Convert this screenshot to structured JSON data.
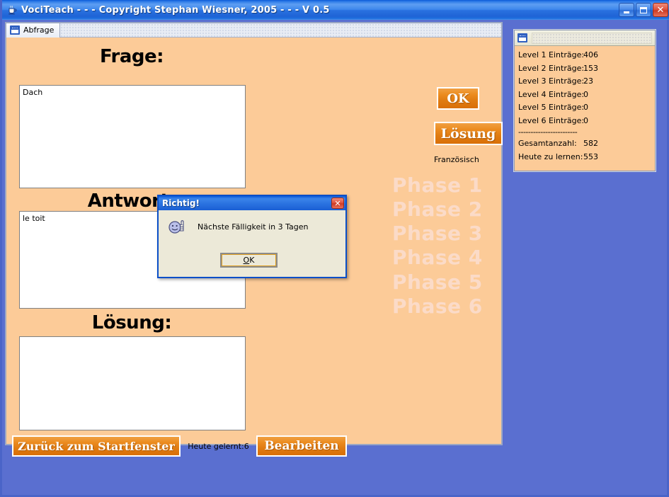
{
  "window": {
    "title": "VociTeach - - - Copyright Stephan Wiesner, 2005 - - -  V 0.5",
    "icon": "java-coffee-cup-icon",
    "minimize_label": "_",
    "maximize_label": "□",
    "close_label": "✕"
  },
  "main_frame": {
    "tab_label": "Abfrage",
    "tab_icon": "window-icon"
  },
  "quiz": {
    "frage_label": "Frage:",
    "frage_value": "Dach",
    "antwort_label": "Antwort:",
    "antwort_value": "le toit",
    "loesung_label": "Lösung:",
    "loesung_value": "",
    "ok_button": "OK",
    "loesung_button": "Lösung",
    "language": "Französisch",
    "phases": [
      "Phase 1",
      "Phase 2",
      "Phase 3",
      "Phase 4",
      "Phase 5",
      "Phase 6"
    ]
  },
  "bottom_bar": {
    "back_button": "Zurück zum Startfenster",
    "learned_today": "Heute gelernt:6",
    "edit_button": "Bearbeiten"
  },
  "stats_frame": {
    "icon": "window-icon",
    "rows": [
      {
        "label": "Level 1 Einträge:",
        "value": "406"
      },
      {
        "label": "Level 2 Einträge:",
        "value": "153"
      },
      {
        "label": "Level 3 Einträge:",
        "value": "23"
      },
      {
        "label": "Level 4 Einträge:",
        "value": "0"
      },
      {
        "label": "Level 5 Einträge:",
        "value": "0"
      },
      {
        "label": "Level 6 Einträge:",
        "value": "0"
      }
    ],
    "separator": "------------------------",
    "totals": [
      {
        "label": "Gesamtanzahl:",
        "value": "582"
      },
      {
        "label": "Heute zu lernen:",
        "value": "553"
      }
    ]
  },
  "dialog": {
    "title": "Richtig!",
    "close_label": "✕",
    "icon": "smiley-thumbs-up-icon",
    "message": "Nächste Fälligkeit in 3 Tagen",
    "ok_button_prefix": "O",
    "ok_button_suffix": "K"
  },
  "colors": {
    "panel_orange": "#fccb98",
    "desktop": "#fbebdb",
    "button_orange": "#e07c12",
    "title_blue": "#2a72e0",
    "phase_text": "#fbdbc8"
  }
}
